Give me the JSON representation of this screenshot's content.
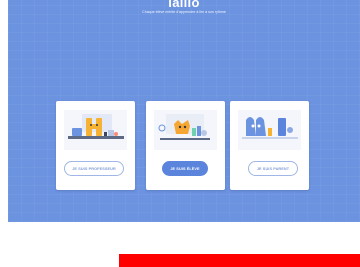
{
  "header": {
    "logo": "lalilo",
    "tagline": "Chaque élève mérite d'apprendre à lire à son rythme"
  },
  "roles": [
    {
      "label": "JE SUIS PROFESSEUR",
      "style": "outline"
    },
    {
      "label": "JE SUIS ÉLÈVE",
      "style": "filled"
    },
    {
      "label": "JE SUIS PARENT",
      "style": "outline"
    }
  ],
  "colors": {
    "hero_background": "#6c93e0",
    "primary_button": "#5b84dc",
    "outline_button_text": "#7f9ad8",
    "bottom_bar": "#ff0000"
  }
}
